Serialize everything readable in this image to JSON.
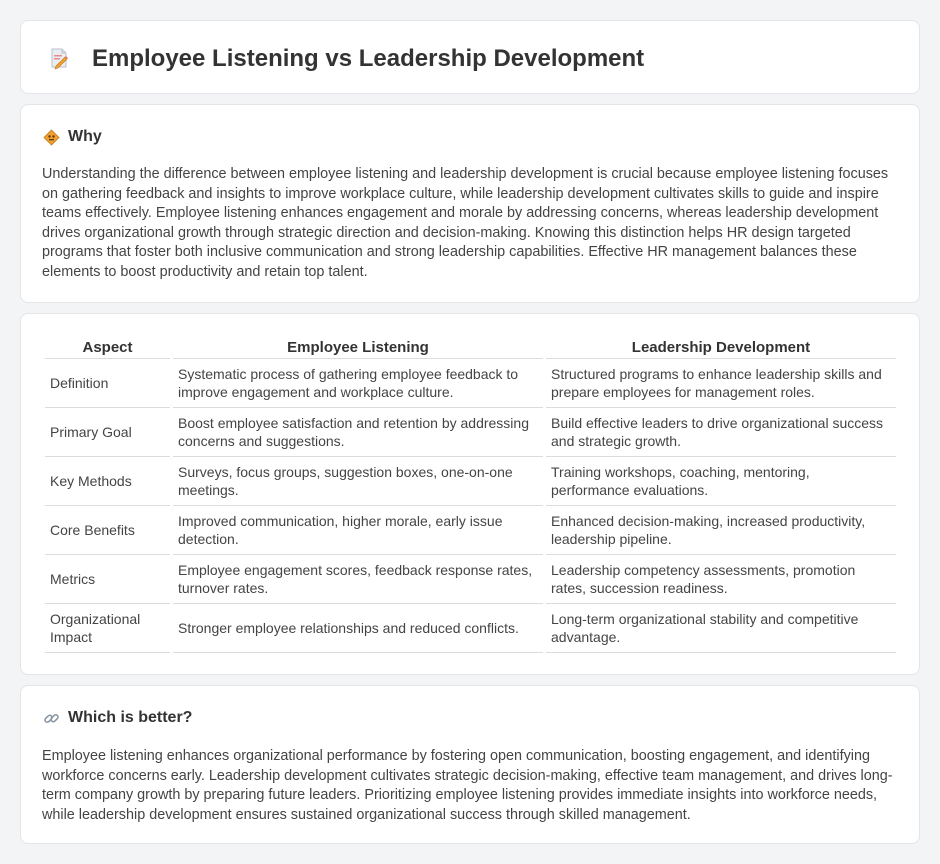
{
  "header": {
    "title": "Employee Listening vs Leadership Development",
    "icon": "document-edit-icon"
  },
  "why": {
    "heading": "Why",
    "icon": "diamond-sign-icon",
    "text": "Understanding the difference between employee listening and leadership development is crucial because employee listening focuses on gathering feedback and insights to improve workplace culture, while leadership development cultivates skills to guide and inspire teams effectively. Employee listening enhances engagement and morale by addressing concerns, whereas leadership development drives organizational growth through strategic direction and decision-making. Knowing this distinction helps HR design targeted programs that foster both inclusive communication and strong leadership capabilities. Effective HR management balances these elements to boost productivity and retain top talent."
  },
  "comparison": {
    "headers": [
      "Aspect",
      "Employee Listening",
      "Leadership Development"
    ],
    "rows": [
      {
        "aspect": "Definition",
        "employee": "Systematic process of gathering employee feedback to improve engagement and workplace culture.",
        "leadership": "Structured programs to enhance leadership skills and prepare employees for management roles."
      },
      {
        "aspect": "Primary Goal",
        "employee": "Boost employee satisfaction and retention by addressing concerns and suggestions.",
        "leadership": "Build effective leaders to drive organizational success and strategic growth."
      },
      {
        "aspect": "Key Methods",
        "employee": "Surveys, focus groups, suggestion boxes, one-on-one meetings.",
        "leadership": "Training workshops, coaching, mentoring, performance evaluations."
      },
      {
        "aspect": "Core Benefits",
        "employee": "Improved communication, higher morale, early issue detection.",
        "leadership": "Enhanced decision-making, increased productivity, leadership pipeline."
      },
      {
        "aspect": "Metrics",
        "employee": "Employee engagement scores, feedback response rates, turnover rates.",
        "leadership": "Leadership competency assessments, promotion rates, succession readiness."
      },
      {
        "aspect": "Organizational Impact",
        "employee": "Stronger employee relationships and reduced conflicts.",
        "leadership": "Long-term organizational stability and competitive advantage."
      }
    ]
  },
  "better": {
    "heading": "Which is better?",
    "icon": "link-icon",
    "text": "Employee listening enhances organizational performance by fostering open communication, boosting engagement, and identifying workforce concerns early. Leadership development cultivates strategic decision-making, effective team management, and drives long-term company growth by preparing future leaders. Prioritizing employee listening provides immediate insights into workforce needs, while leadership development ensures sustained organizational success through skilled management."
  },
  "colors": {
    "background": "#f3f4f6",
    "card": "#ffffff",
    "icon_accent": "#f0a030",
    "icon_pink": "#e0707a"
  }
}
